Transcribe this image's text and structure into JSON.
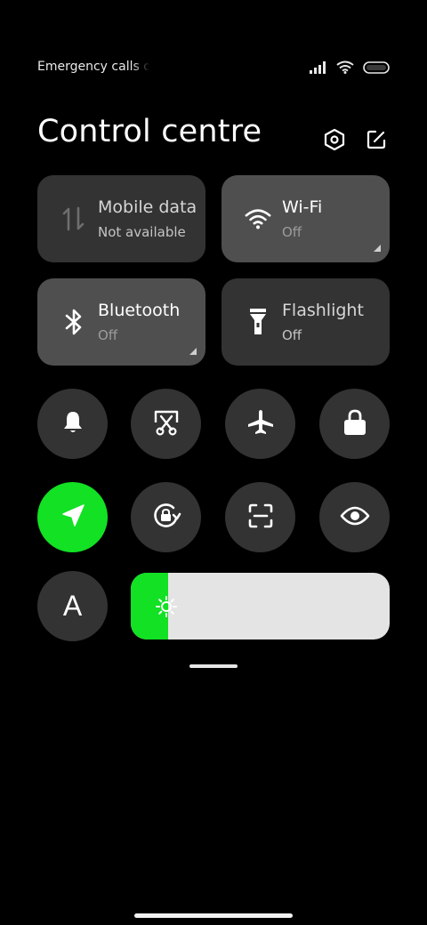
{
  "status_bar": {
    "carrier_text": "Emergency calls only",
    "icons": [
      "signal-icon",
      "wifi-icon",
      "battery-icon"
    ]
  },
  "header": {
    "title": "Control centre",
    "settings_icon": "hexagon-settings-icon",
    "edit_icon": "edit-icon"
  },
  "tiles": [
    {
      "name": "Mobile data",
      "status": "Not available",
      "icon": "mobile-data-icon",
      "state": "disabled"
    },
    {
      "name": "Wi-Fi",
      "status": "Off",
      "icon": "wifi-icon",
      "state": "off",
      "has_more": true
    },
    {
      "name": "Bluetooth",
      "status": "Off",
      "icon": "bluetooth-icon",
      "state": "off",
      "has_more": true
    },
    {
      "name": "Flashlight",
      "status": "Off",
      "icon": "flashlight-icon",
      "state": "disabled"
    }
  ],
  "quick_toggles": [
    {
      "icon": "bell-icon",
      "active": false
    },
    {
      "icon": "screenshot-icon",
      "active": false
    },
    {
      "icon": "airplane-icon",
      "active": false
    },
    {
      "icon": "lock-icon",
      "active": false
    },
    {
      "icon": "location-icon",
      "active": true
    },
    {
      "icon": "rotation-lock-icon",
      "active": false
    },
    {
      "icon": "scanner-icon",
      "active": false
    },
    {
      "icon": "eye-icon",
      "active": false
    }
  ],
  "auto_brightness": {
    "label": "A",
    "active": false
  },
  "brightness": {
    "level_fraction": 0.145,
    "icon": "sun-icon"
  },
  "colors": {
    "active": "#12e124",
    "tile_off": "#4f4f4f",
    "tile_disabled": "#333333",
    "round_bg": "#333333",
    "slider_track": "#e4e4e4"
  }
}
